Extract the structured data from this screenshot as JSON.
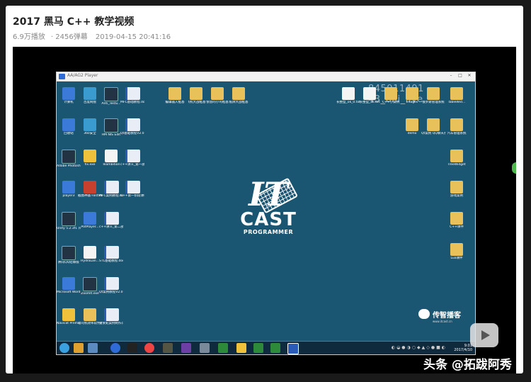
{
  "header": {
    "title": "2017 黑马 C++ 教学视频",
    "views": "6.9万播放",
    "danmaku": "2456弹幕",
    "date": "2019-04-15 20:41:16"
  },
  "player": {
    "window_title": "AA/AG2 Player",
    "watermark": "845911491​43_bili_live",
    "brand_top": "IT",
    "brand_mid": "CAST",
    "brand_bottom": "PROGRAMMER",
    "corner_name": "传智播客",
    "corner_url": "www.itcast.cn",
    "clock_time": "9:01",
    "clock_date": "2017/4/10"
  },
  "desktop_icons": [
    {
      "label": "计算机",
      "glyph": "g-blue"
    },
    {
      "label": "百度网盘",
      "glyph": "g-teal"
    },
    {
      "label": "Anti_Testu...",
      "glyph": "g-dark"
    },
    {
      "label": "MFC基础教程.doc",
      "glyph": "g-doc"
    },
    {
      "label": "回收站",
      "glyph": "g-blue"
    },
    {
      "label": "360安全",
      "glyph": "g-teal"
    },
    {
      "label": "HM NIS Edit",
      "glyph": "g-dark"
    },
    {
      "label": "Qt基础教程V2.0.doc",
      "glyph": "g-doc"
    },
    {
      "label": "Adobe Photosh...",
      "glyph": "g-dark"
    },
    {
      "label": "fix.exe",
      "glyph": "g-yellow"
    },
    {
      "label": "Teambition",
      "glyph": "g-white"
    },
    {
      "label": "c++讲义_第一部分.doc",
      "glyph": "g-doc"
    },
    {
      "label": "player3",
      "glyph": "g-blue"
    },
    {
      "label": "截图神器 FastStone...",
      "glyph": "g-red"
    },
    {
      "label": "MFC案例教程.doc",
      "glyph": "g-doc"
    },
    {
      "label": "C++第一阶段课程设...",
      "glyph": "g-doc"
    },
    {
      "label": "Unity 5.2.3f1 (64-bit)",
      "glyph": "g-dark"
    },
    {
      "label": "PotPlayer...",
      "glyph": "g-blue"
    },
    {
      "label": "c++讲义_第二部分.doc",
      "glyph": "g-doc"
    },
    {
      "label": "腾讯QQ轻聊版",
      "glyph": "g-dark"
    },
    {
      "label": "HydraLan...",
      "glyph": "g-white"
    },
    {
      "label": "STL基础教程.doc",
      "glyph": "g-doc"
    },
    {
      "label": "Microsoft Word 2010",
      "glyph": "g-blue"
    },
    {
      "label": "ZoomIt.exe",
      "glyph": "g-dark"
    },
    {
      "label": "Qt案例教程V2.0.doc",
      "glyph": "g-doc"
    },
    {
      "label": "Navicat Premium",
      "glyph": "g-yellow"
    },
    {
      "label": "老司机效率软件教程",
      "glyph": "g-folder"
    },
    {
      "label": "贪食蛇案例制作(新...",
      "glyph": "g-doc"
    },
    {
      "label": "编辑器入框基",
      "glyph": "g-folder"
    },
    {
      "label": "飞机大战框基",
      "glyph": "g-folder"
    },
    {
      "label": "愤怒的小鸟框基",
      "glyph": "g-folder"
    },
    {
      "label": "纸牌大战框基",
      "glyph": "g-folder"
    },
    {
      "label": "长整型_ok_0.txt",
      "glyph": "g-white"
    },
    {
      "label": "长整型_ok.txt",
      "glyph": "g-white"
    },
    {
      "label": "C++小案例",
      "glyph": "g-folder"
    },
    {
      "label": "images",
      "glyph": "g-folder"
    },
    {
      "label": "俄罗斯管理系统",
      "glyph": "g-folder"
    },
    {
      "label": "TableWid...",
      "glyph": "g-folder"
    },
    {
      "label": "demo",
      "glyph": "g-folder"
    },
    {
      "label": "Qt案例 QQ聊天系统",
      "glyph": "g-folder"
    },
    {
      "label": "汽车管理系统",
      "glyph": "g-folder"
    },
    {
      "label": "TreeWidget",
      "glyph": "g-folder"
    },
    {
      "label": "游戏案例",
      "glyph": "g-folder"
    },
    {
      "label": "C++课件",
      "glyph": "g-folder"
    },
    {
      "label": "Lua课件",
      "glyph": "g-folder"
    }
  ],
  "source_label": "头条 @拓跋阿秀"
}
